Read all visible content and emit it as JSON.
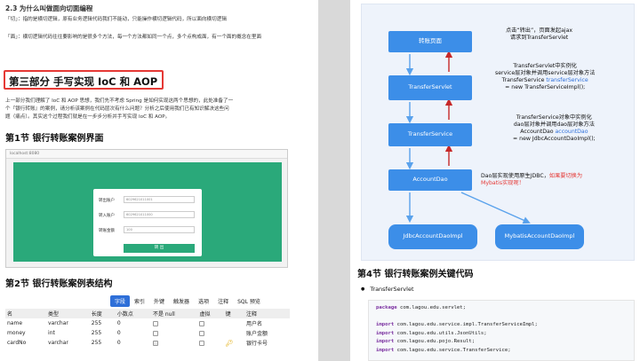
{
  "left": {
    "heading_23": "2.3 为什么叫做面向切面编程",
    "para_qie": "「切」：指的是横切逻辑，原有业务逻辑代码我们不能动，只能操作横切逻辑代码，所以面向横切逻辑",
    "para_mian": "「面」：横切逻辑代码往往要影响的是很多个方法，每一个方法都如同一个点，多个点构成面，有一个面的概念在里面",
    "part3_title": "第三部分 手写实现 IoC 和 AOP",
    "intro_line1": "上一部分我们理解了 IoC 和 AOP 思想，我们先不考虑 Spring 是如何实现这两个思想的，此处准备了一",
    "intro_line2": "个『银行转账』的案例，请分析该案例在代码层次有什么问题？分析之后使用我们已有知识解决这些问",
    "intro_line3": "题（痛点）。其实这个过程我们就是在一步步分析并手写实现 IoC 和 AOP。",
    "sec1_title": "第1节 银行转账案例界面",
    "screenshot": {
      "tab": "localhost:8080",
      "rows": [
        {
          "label": "转出账户",
          "value": "6029621011001"
        },
        {
          "label": "转入账户",
          "value": "6029621011000"
        },
        {
          "label": "转账金额",
          "value": "100"
        }
      ],
      "button": "转 出"
    },
    "sec2_title": "第2节 银行转账案例表结构",
    "tabs": [
      "字段",
      "索引",
      "外键",
      "触发器",
      "选项",
      "注释",
      "SQL 预览"
    ],
    "table": {
      "headers": [
        "名",
        "类型",
        "长度",
        "小数点",
        "不是 null",
        "虚拟",
        "键",
        "注释"
      ],
      "rows": [
        {
          "name": "name",
          "type": "varchar",
          "len": "255",
          "dec": "0",
          "notnull": false,
          "key": "",
          "comment": "用户名"
        },
        {
          "name": "money",
          "type": "int",
          "len": "255",
          "dec": "0",
          "notnull": false,
          "key": "",
          "comment": "账户金额"
        },
        {
          "name": "cardNo",
          "type": "varchar",
          "len": "255",
          "dec": "0",
          "notnull": true,
          "key": "key-icon",
          "comment": "银行卡号"
        }
      ]
    }
  },
  "right": {
    "diagram": {
      "nodes": {
        "page": "转账页面",
        "servlet": "TransferServlet",
        "service": "TransferService",
        "dao": "AccountDao",
        "jdbc": "JdbcAccountDaoImpl",
        "mybatis": "MybatisAccountDaoImpl"
      },
      "notes": {
        "n1_l1": "点击“转出”，页面发起ajax",
        "n1_l2": "请求到TransferServlet",
        "n2_l1": "TransferServlet中实例化",
        "n2_l2": "service层对象并调用service层对象方法",
        "n2_l3a": "TransferService ",
        "n2_l3b": "transferService",
        "n2_l4": "= new TransferServiceImpl();",
        "n3_l1": "TransferService对象中实例化",
        "n3_l2": "dao层对象并调用dao层对象方法",
        "n3_l3a": "AccountDao ",
        "n3_l3b": "accountDao",
        "n3_l4": "= new JdbcAccountDaoImpl();",
        "n4_l1a": "Dao层实现使用原生JDBC，",
        "n4_l1b": "如果要切换为",
        "n4_l2": "Mybatis实现呢！"
      }
    },
    "sec4_title": "第4节 银行转账案例关键代码",
    "bullet": "TransferServlet",
    "code": [
      {
        "kw": "package",
        "rest": " com.lagou.edu.servlet;"
      },
      {
        "kw": "",
        "rest": ""
      },
      {
        "kw": "import",
        "rest": " com.lagou.edu.service.impl.TransferServiceImpl;"
      },
      {
        "kw": "import",
        "rest": " com.lagou.edu.utils.JsonUtils;"
      },
      {
        "kw": "import",
        "rest": " com.lagou.edu.pojo.Result;"
      },
      {
        "kw": "import",
        "rest": " com.lagou.edu.service.TransferService;"
      }
    ]
  },
  "colors": {
    "node": "#3c8ee8",
    "highlight_red": "#e53935",
    "screenshot_green": "#2aa97a",
    "tab_active": "#2e6fd8"
  }
}
